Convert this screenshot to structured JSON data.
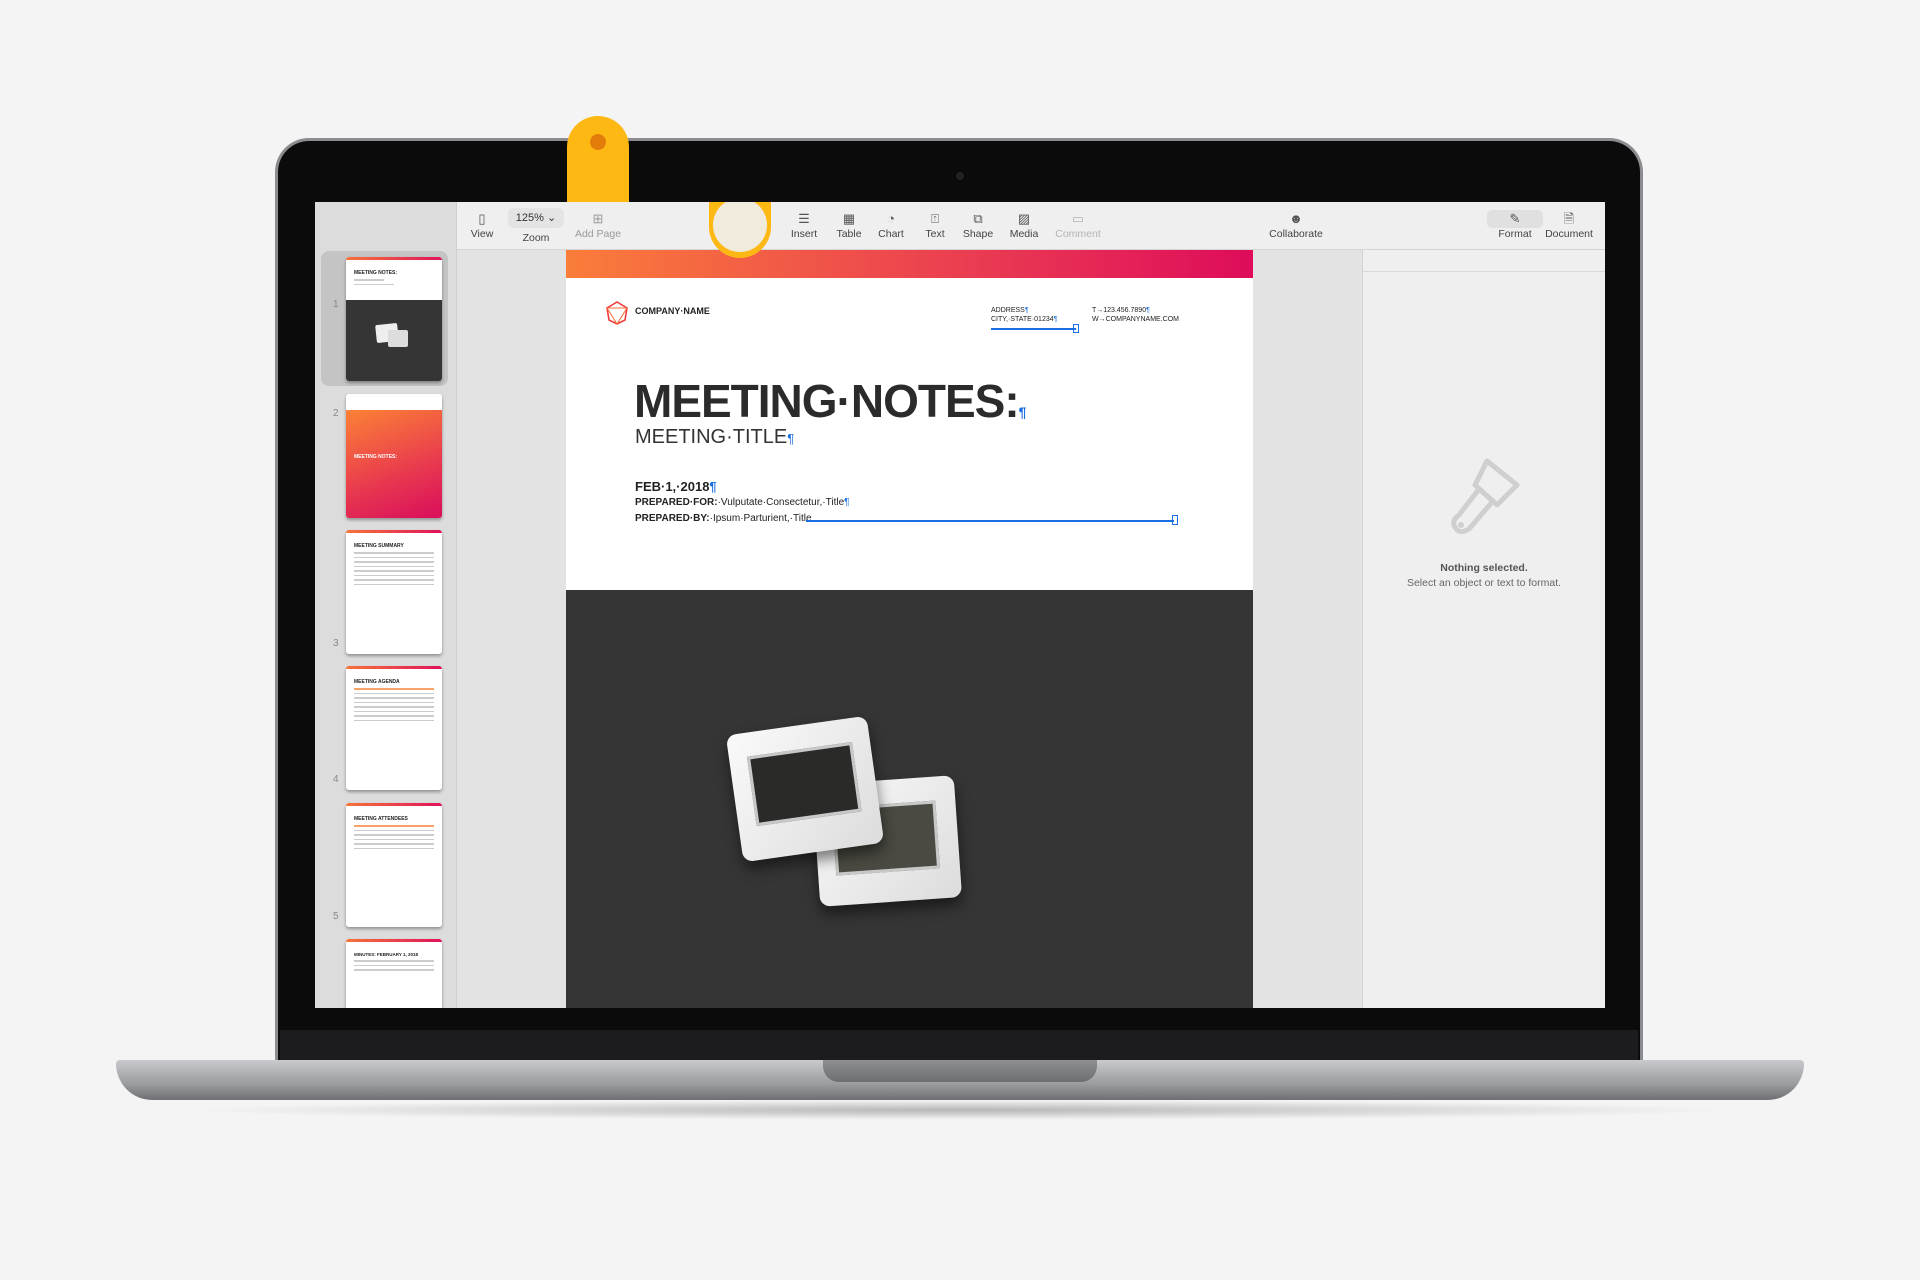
{
  "toolbar": {
    "view": {
      "label": "View",
      "icon": "sidebar-icon"
    },
    "zoom": {
      "label": "Zoom",
      "value": "125%"
    },
    "add_page": {
      "label": "Add Page",
      "icon": "plus-square-icon"
    },
    "insert": {
      "label": "Insert",
      "icon": "insert-list-icon"
    },
    "table": {
      "label": "Table",
      "icon": "table-icon"
    },
    "chart": {
      "label": "Chart",
      "icon": "chart-icon"
    },
    "text": {
      "label": "Text",
      "icon": "text-box-icon"
    },
    "shape": {
      "label": "Shape",
      "icon": "shape-icon"
    },
    "media": {
      "label": "Media",
      "icon": "image-icon"
    },
    "comment": {
      "label": "Comment",
      "icon": "comment-icon"
    },
    "collaborate": {
      "label": "Collaborate",
      "icon": "collaborate-icon"
    },
    "format": {
      "label": "Format",
      "icon": "paintbrush-icon"
    },
    "document": {
      "label": "Document",
      "icon": "document-icon"
    }
  },
  "thumbnails": [
    {
      "num": "1",
      "heading": "MEETING NOTES:"
    },
    {
      "num": "2",
      "heading": "MEETING NOTES:"
    },
    {
      "num": "3",
      "heading": "MEETING SUMMARY"
    },
    {
      "num": "4",
      "heading": "MEETING AGENDA"
    },
    {
      "num": "5",
      "heading": "MEETING ATTENDEES"
    },
    {
      "num": "",
      "heading": "MINUTES: FEBRUARY 1, 2018"
    }
  ],
  "document": {
    "company": "COMPANY·NAME",
    "address1": "ADDRESS",
    "address2": "CITY,·STATE·01234",
    "phone": "T→123.456.7890",
    "web": "W→COMPANYNAME.COM",
    "title": "MEETING·NOTES:",
    "subtitle": "MEETING·TITLE",
    "date": "FEB·1,·2018",
    "prepared_for_label": "PREPARED·FOR:",
    "prepared_for": "·Vulputate·Consectetur,·Title",
    "prepared_by_label": "PREPARED·BY:",
    "prepared_by": "·Ipsum·Parturient,·Title",
    "pilcrow": "¶"
  },
  "inspector": {
    "empty_title": "Nothing selected.",
    "empty_hint": "Select an object or text to format."
  },
  "colors": {
    "accent_orange": "#fa7d3a",
    "accent_pink": "#de0c5b",
    "callout": "#fdb813",
    "selection_blue": "#1a6fe0"
  }
}
